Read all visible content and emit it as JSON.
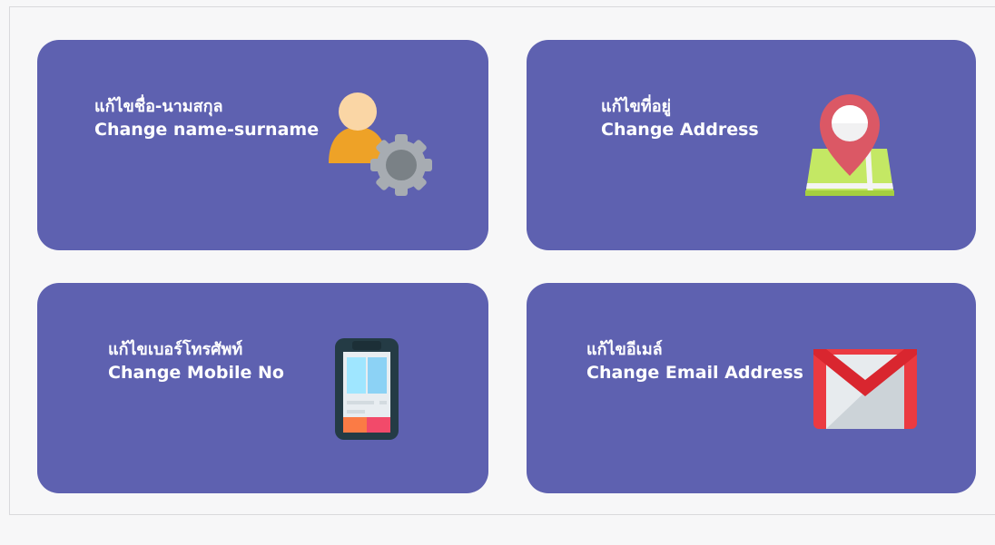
{
  "cards": [
    {
      "thai": "แก้ไขชื่อ-นามสกุล",
      "english": "Change name-surname",
      "icon": "user-settings-icon"
    },
    {
      "thai": "แก้ไขที่อยู่",
      "english": "Change Address",
      "icon": "map-pin-icon"
    },
    {
      "thai": "แก้ไขเบอร์โทรศัพท์",
      "english": "Change Mobile No",
      "icon": "mobile-phone-icon"
    },
    {
      "thai": "แก้ไขอีเมล์",
      "english": "Change Email Address",
      "icon": "email-icon"
    }
  ],
  "colors": {
    "background": "#f7f7f8",
    "card": "#5e61b0",
    "text": "#ffffff"
  }
}
